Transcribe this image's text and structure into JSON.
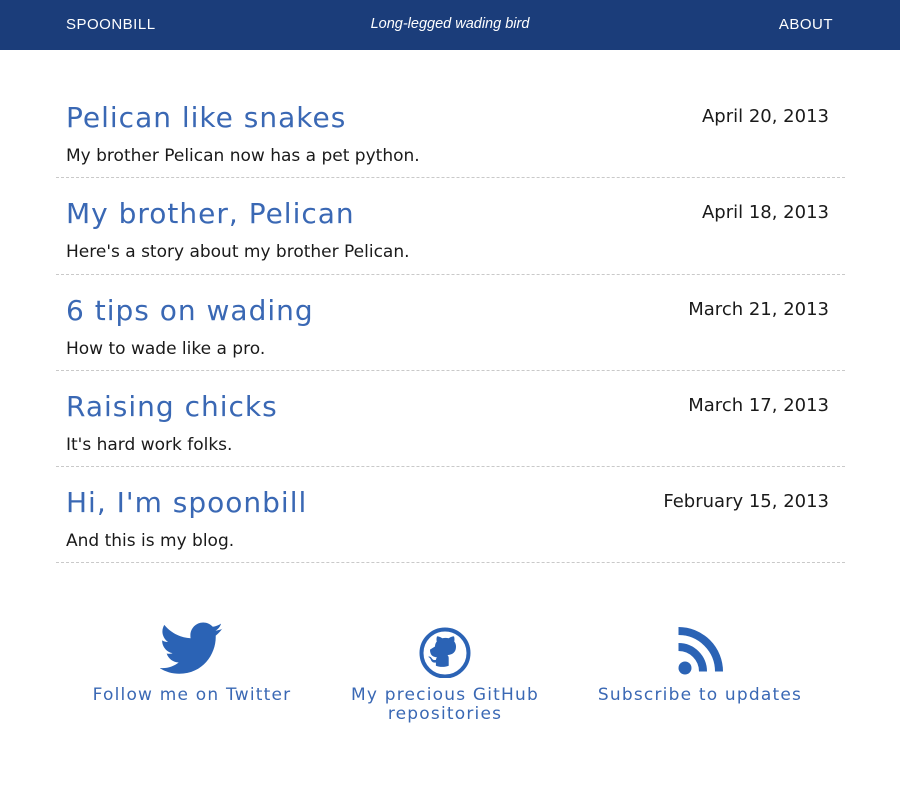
{
  "header": {
    "brand": "SPOONBILL",
    "tagline": "Long-legged wading bird",
    "about": "ABOUT"
  },
  "posts": [
    {
      "title": "Pelican like snakes",
      "date": "April 20, 2013",
      "summary": "My brother Pelican now has a pet python."
    },
    {
      "title": "My brother, Pelican",
      "date": "April 18, 2013",
      "summary": "Here's a story about my brother Pelican."
    },
    {
      "title": "6 tips on wading",
      "date": "March 21, 2013",
      "summary": "How to wade like a pro."
    },
    {
      "title": "Raising chicks",
      "date": "March 17, 2013",
      "summary": "It's hard work folks."
    },
    {
      "title": "Hi, I'm spoonbill",
      "date": "February 15, 2013",
      "summary": "And this is my blog."
    }
  ],
  "links": {
    "twitter": {
      "label": "Follow me on Twitter",
      "icon": "twitter-icon"
    },
    "github": {
      "label_line1": "My precious GitHub",
      "label_line2": "repositories",
      "icon": "github-icon"
    },
    "rss": {
      "label": "Subscribe to updates",
      "icon": "rss-icon"
    }
  },
  "colors": {
    "header_bg": "#1b3d7a",
    "accent": "#3a68b4",
    "icon": "#2b63b5"
  }
}
